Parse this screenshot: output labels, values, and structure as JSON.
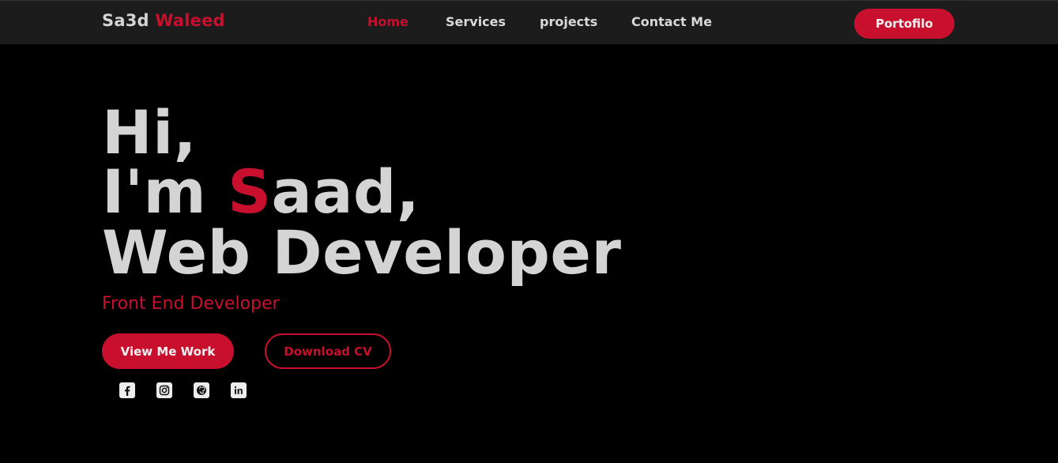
{
  "colors": {
    "accent": "#c8102e",
    "background": "#000000",
    "navbar": "#1c1c1c",
    "text": "#d4d4d4"
  },
  "brand": {
    "first": "Sa3d",
    "last": "Waleed"
  },
  "nav": {
    "links": [
      {
        "label": "Home",
        "active": true
      },
      {
        "label": "Services",
        "active": false
      },
      {
        "label": "projects",
        "active": false
      },
      {
        "label": "Contact Me",
        "active": false
      }
    ],
    "cta_label": "Portofilo"
  },
  "hero": {
    "line1": "Hi,",
    "line2_prefix": "I'm ",
    "line2_accent": "S",
    "line2_suffix": "aad,",
    "line3": "Web Developer",
    "subtitle": "Front End Developer",
    "primary_button": "View Me Work",
    "secondary_button": "Download CV"
  },
  "social": [
    {
      "icon": "facebook-icon"
    },
    {
      "icon": "instagram-icon"
    },
    {
      "icon": "github-icon"
    },
    {
      "icon": "linkedin-icon"
    }
  ]
}
